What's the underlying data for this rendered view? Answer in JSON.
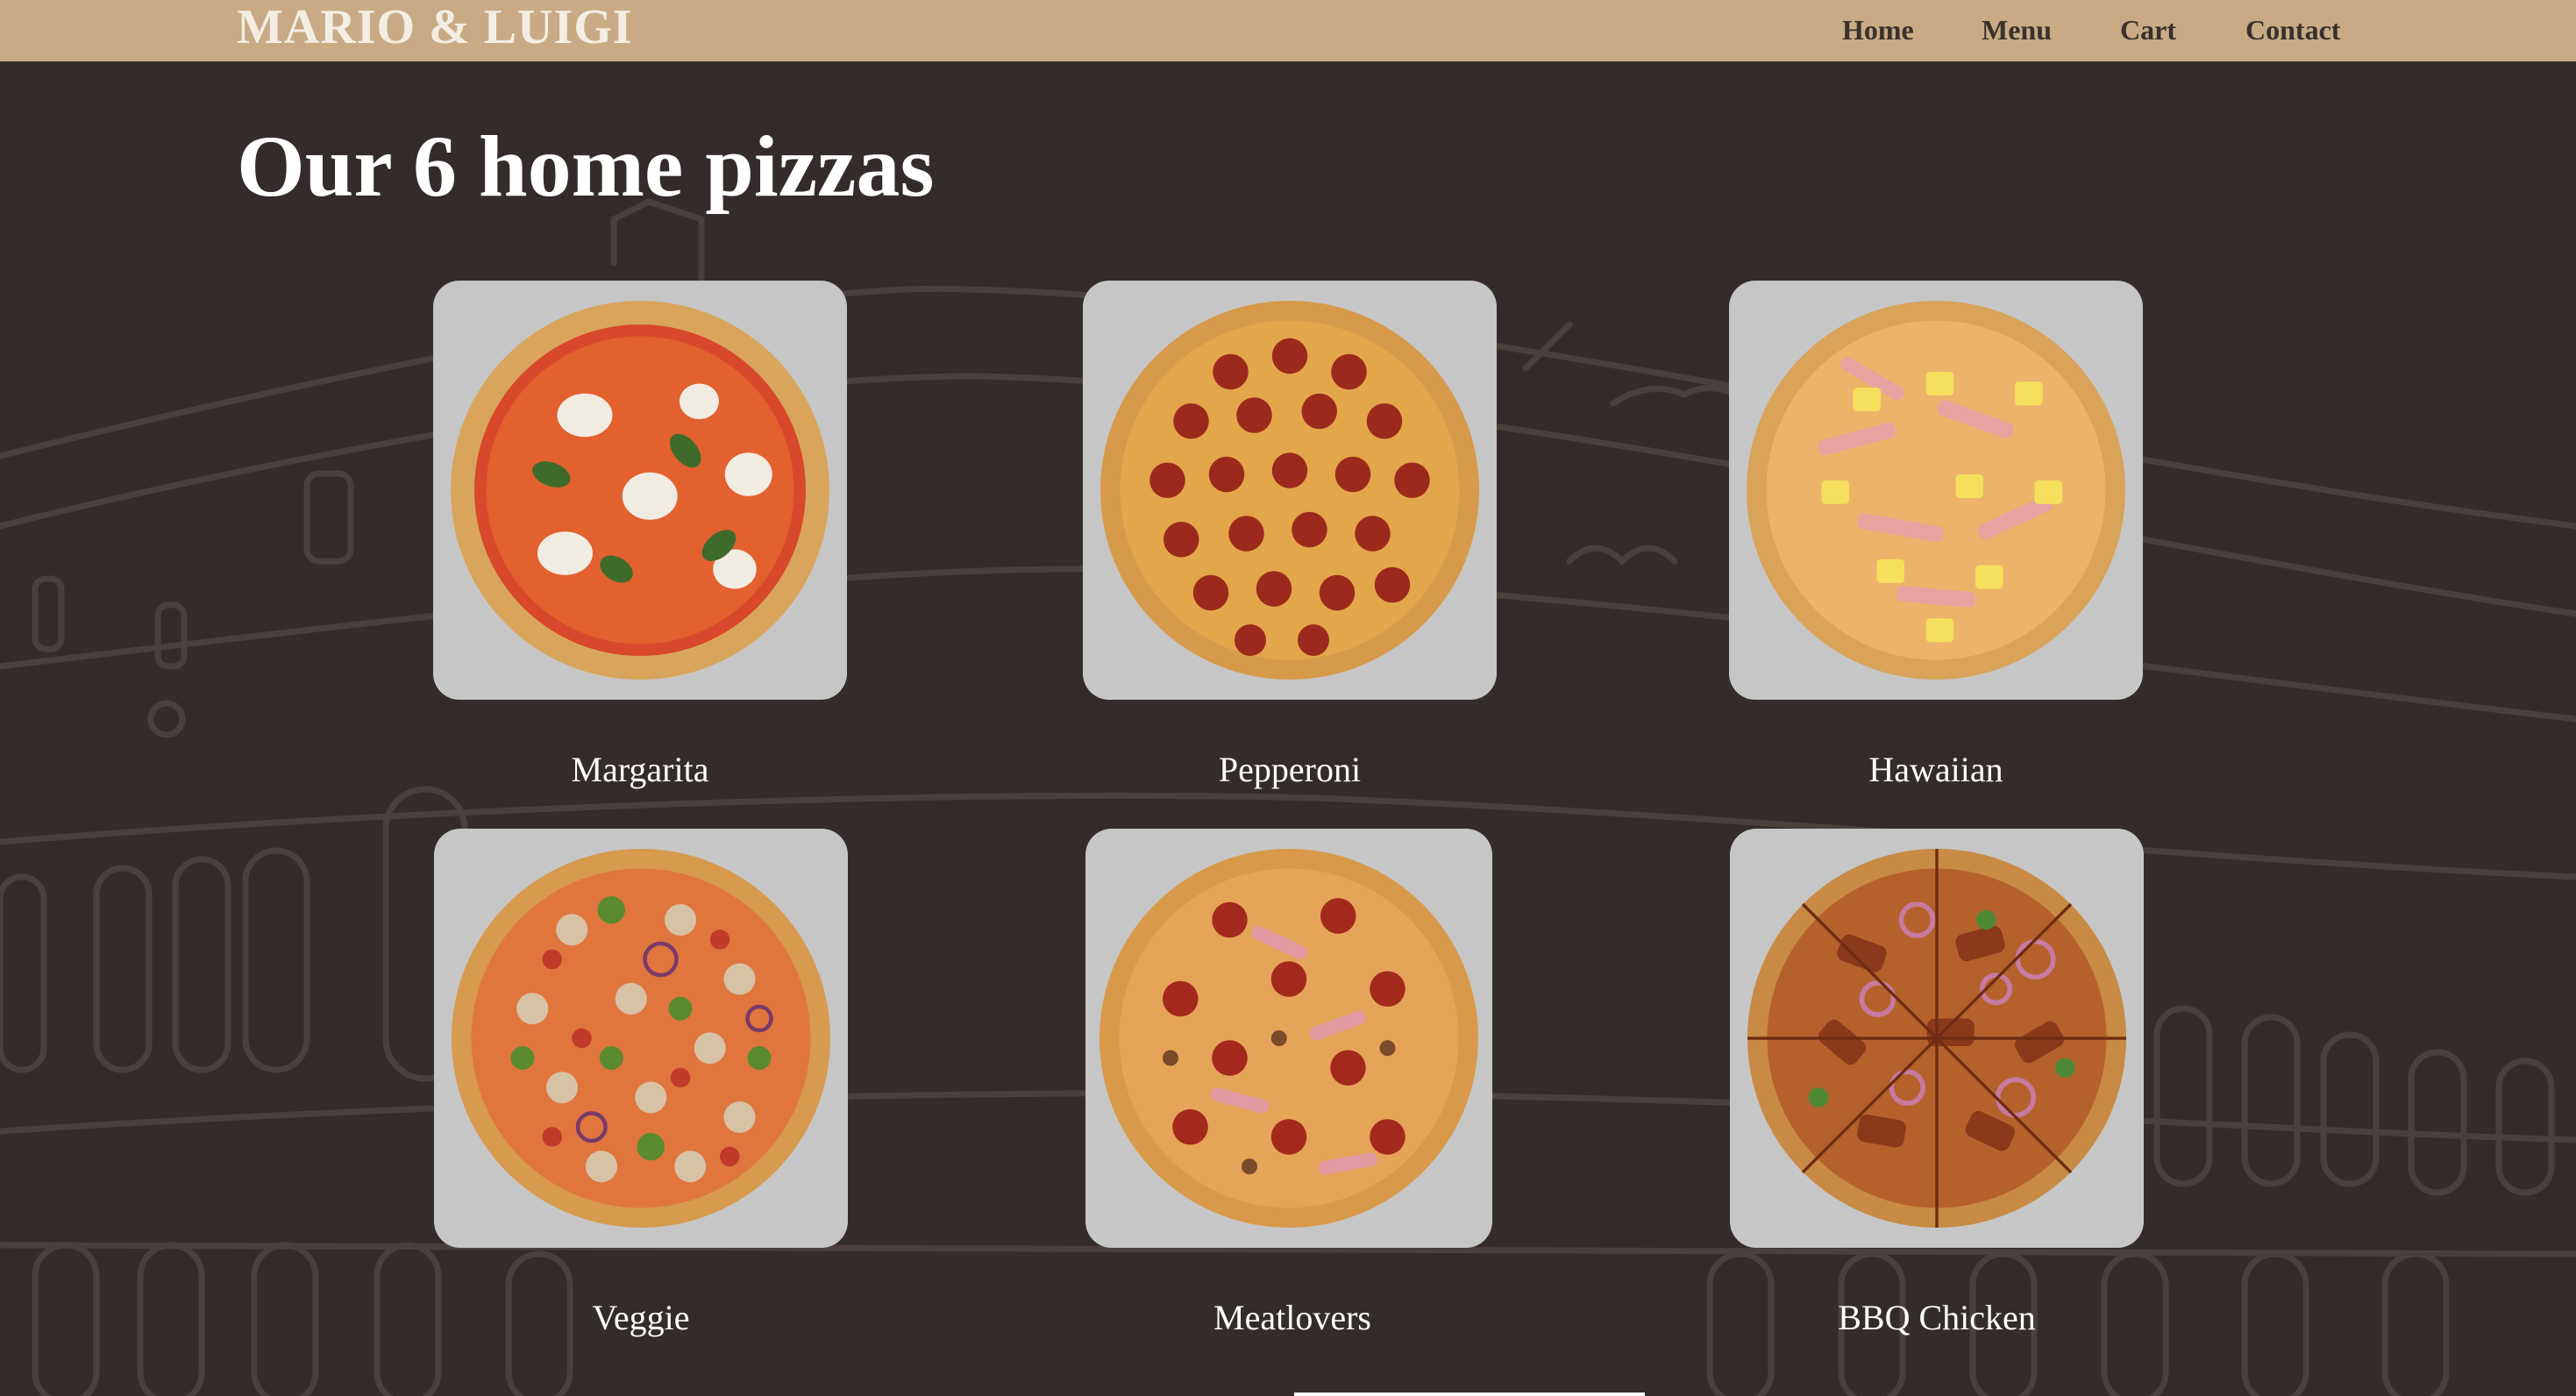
{
  "header": {
    "brand": "MARIO & LUIGI",
    "nav": [
      {
        "label": "Home"
      },
      {
        "label": "Menu"
      },
      {
        "label": "Cart"
      },
      {
        "label": "Contact"
      }
    ]
  },
  "main": {
    "title": "Our 6 home pizzas",
    "pizzas": [
      {
        "name": "Margarita",
        "image": "margarita-pizza-image"
      },
      {
        "name": "Pepperoni",
        "image": "pepperoni-pizza-image"
      },
      {
        "name": "Hawaiian",
        "image": "hawaiian-pizza-image"
      },
      {
        "name": "Veggie",
        "image": "veggie-pizza-image"
      },
      {
        "name": "Meatlovers",
        "image": "meatlovers-pizza-image"
      },
      {
        "name": "BBQ Chicken",
        "image": "bbq-chicken-pizza-image"
      }
    ]
  },
  "colors": {
    "navbar": "#c8ab85",
    "background": "#342c2b",
    "card": "#c6c6c6",
    "brand_text": "#f4ede3",
    "nav_text": "#3a302c"
  }
}
